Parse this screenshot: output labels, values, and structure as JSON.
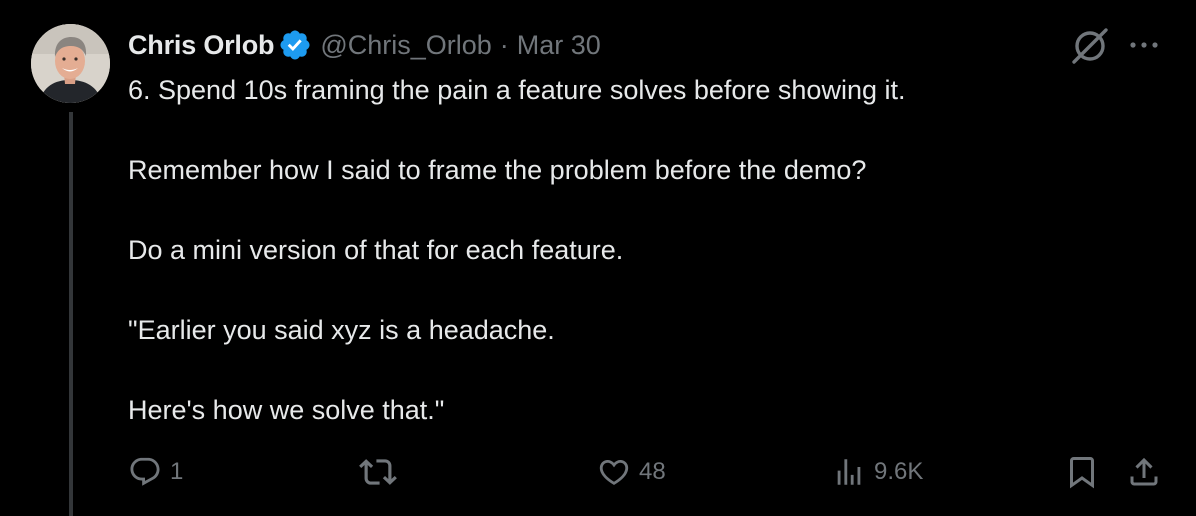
{
  "tweet": {
    "author": {
      "name": "Chris Orlob",
      "handle": "@Chris_Orlob",
      "verified": true,
      "verified_color": "#1d9bf0"
    },
    "separator": "·",
    "date": "Mar 30",
    "body": [
      "6. Spend 10s framing the pain a feature solves before showing it.",
      "Remember how I said to frame the problem before the demo?",
      "Do a mini version of that for each feature.",
      "\"Earlier you said xyz is a headache.",
      "Here's how we solve that.\""
    ],
    "actions": {
      "reply": {
        "icon": "reply-icon",
        "count": "1"
      },
      "retweet": {
        "icon": "retweet-icon",
        "count": ""
      },
      "like": {
        "icon": "heart-icon",
        "count": "48"
      },
      "views": {
        "icon": "views-icon",
        "count": "9.6K"
      },
      "bookmark": {
        "icon": "bookmark-icon"
      },
      "share": {
        "icon": "share-icon"
      }
    },
    "top_actions": {
      "grok": {
        "icon": "grok-icon"
      },
      "more": {
        "icon": "more-icon"
      }
    }
  },
  "colors": {
    "background": "#000000",
    "text_primary": "#e7e9ea",
    "text_secondary": "#71767b",
    "thread_line": "#333639"
  }
}
